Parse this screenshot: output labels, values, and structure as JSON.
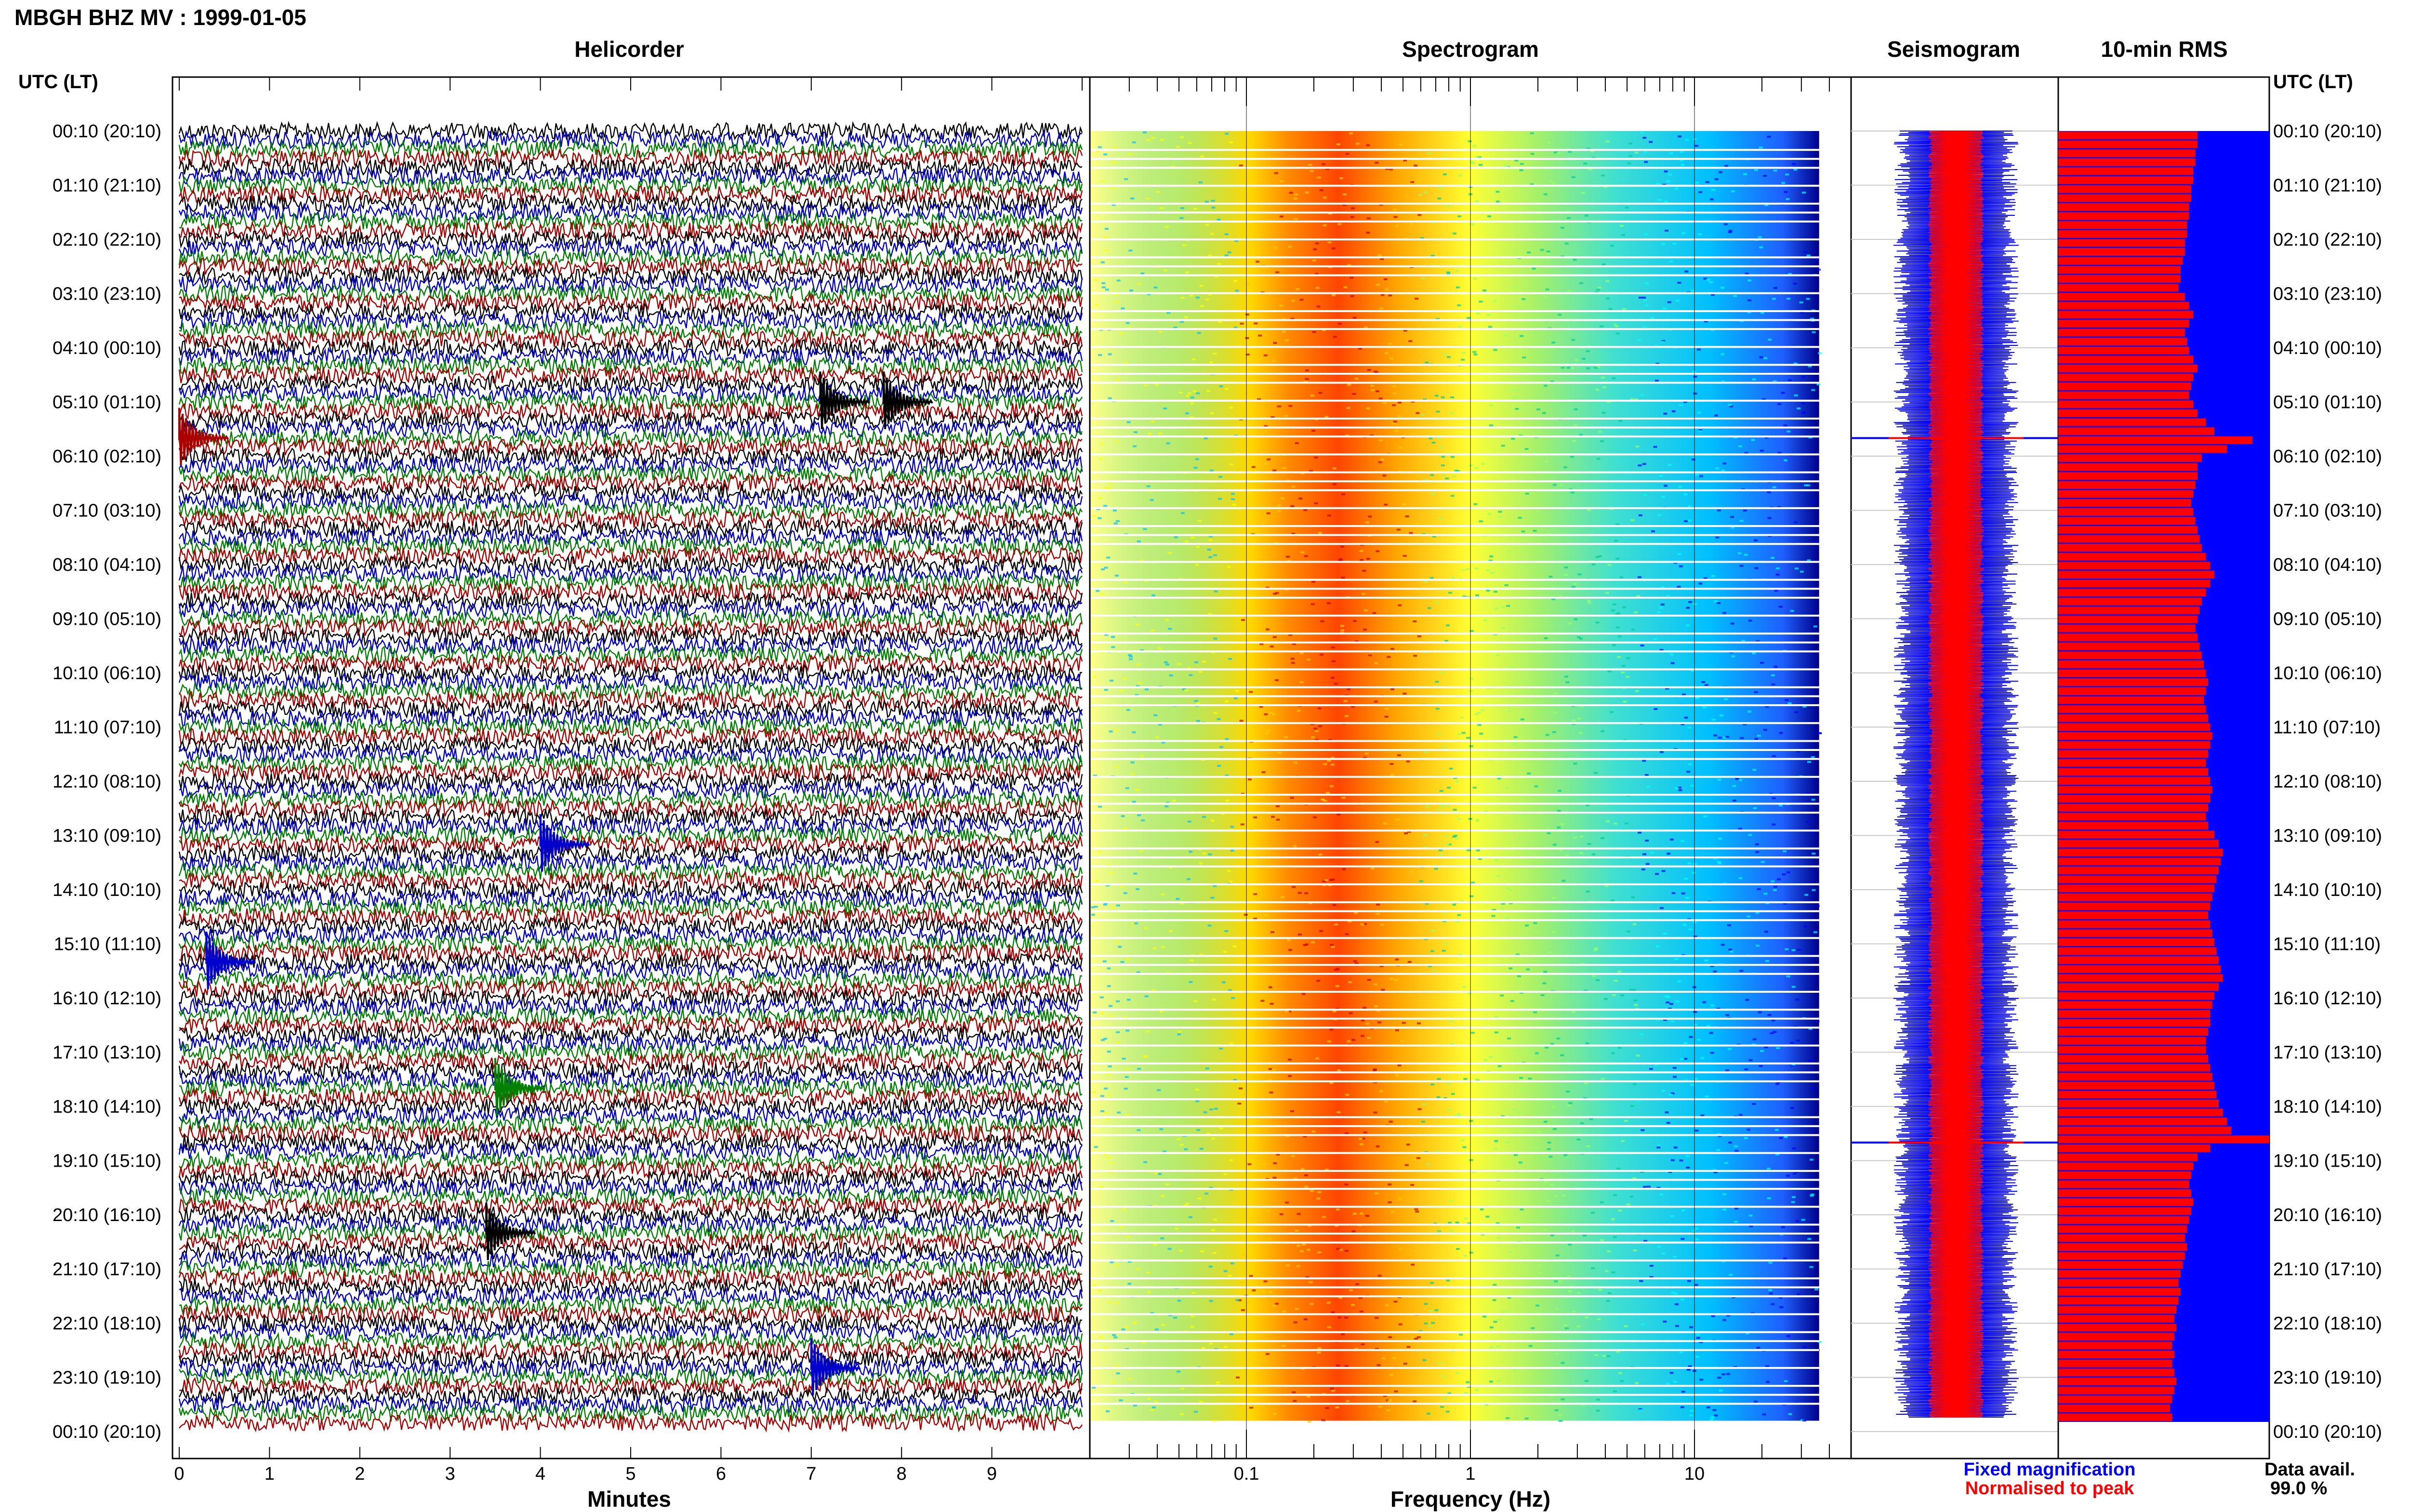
{
  "header": {
    "title": "MBGH BHZ MV : 1999-01-05",
    "utc_label_left": "UTC (LT)",
    "utc_label_right": "UTC (LT)"
  },
  "panels": {
    "helicorder": "Helicorder",
    "spectrogram": "Spectrogram",
    "seismogram": "Seismogram",
    "rms": "10-min RMS"
  },
  "time_labels": [
    "00:10 (20:10)",
    "01:10 (21:10)",
    "02:10 (22:10)",
    "03:10 (23:10)",
    "04:10 (00:10)",
    "05:10 (01:10)",
    "06:10 (02:10)",
    "07:10 (03:10)",
    "08:10 (04:10)",
    "09:10 (05:10)",
    "10:10 (06:10)",
    "11:10 (07:10)",
    "12:10 (08:10)",
    "13:10 (09:10)",
    "14:10 (10:10)",
    "15:10 (11:10)",
    "16:10 (12:10)",
    "17:10 (13:10)",
    "18:10 (14:10)",
    "19:10 (15:10)",
    "20:10 (16:10)",
    "21:10 (17:10)",
    "22:10 (18:10)",
    "23:10 (19:10)",
    "00:10 (20:10)"
  ],
  "legend": {
    "fixed": "Fixed magnification",
    "normalised": "Normalised to peak",
    "fixed_color": "#0000ff",
    "normalised_color": "#ff0000",
    "data_avail_label": "Data avail.",
    "data_avail_value": "99.0 %"
  },
  "chart_data": [
    {
      "type": "line",
      "panel": "Helicorder",
      "xlabel": "Minutes",
      "xlim": [
        0,
        10
      ],
      "x_ticks": [
        "0",
        "1",
        "2",
        "3",
        "4",
        "5",
        "6",
        "7",
        "8",
        "9"
      ],
      "ylim_utc": [
        "00:10",
        "00:10 next day"
      ],
      "trace_colors": [
        "#000000",
        "#0000cc",
        "#008000",
        "#aa0000"
      ],
      "events": [
        {
          "utc": "05:10",
          "minute": 7.1,
          "color": "#000000"
        },
        {
          "utc": "05:10",
          "minute": 7.8,
          "color": "#000000"
        },
        {
          "utc": "05:50",
          "minute": 0.0,
          "color": "#aa0000",
          "note_visible": false
        },
        {
          "utc": "13:20",
          "minute": 4.0,
          "color": "#0000cc"
        },
        {
          "utc": "15:30",
          "minute": 0.3,
          "color": "#0000cc"
        },
        {
          "utc": "17:50",
          "minute": 3.5,
          "color": "#008000"
        },
        {
          "utc": "20:30",
          "minute": 3.4,
          "color": "#000000"
        },
        {
          "utc": "23:00",
          "minute": 7.0,
          "color": "#0000cc"
        }
      ]
    },
    {
      "type": "heatmap",
      "panel": "Spectrogram",
      "xlabel": "Frequency (Hz)",
      "x_scale": "log",
      "xlim": [
        0.02,
        50
      ],
      "x_ticks": [
        "0.1",
        "1",
        "10"
      ],
      "colormap": [
        "#00008b",
        "#0000ff",
        "#00bfff",
        "#00ffff",
        "#7fff7f",
        "#ffff00",
        "#ffa500",
        "#ff4500",
        "#cc0000"
      ],
      "peak_band_hz": [
        0.18,
        0.5
      ],
      "missing_data_color": "#ffffff"
    },
    {
      "type": "line",
      "panel": "Seismogram",
      "series": [
        {
          "name": "Fixed magnification",
          "color": "#0000ff"
        },
        {
          "name": "Normalised to peak",
          "color": "#ff0000"
        }
      ],
      "spikes_utc": [
        "05:50",
        "18:50"
      ]
    },
    {
      "type": "bar",
      "panel": "10-min RMS",
      "orientation": "horizontal",
      "series": [
        {
          "name": "Fixed magnification",
          "color": "#0000ff"
        },
        {
          "name": "Normalised to peak",
          "color": "#ff0000"
        }
      ],
      "bins_per_hour": 6,
      "rms_relative": [
        0.66,
        0.66,
        0.65,
        0.65,
        0.64,
        0.64,
        0.63,
        0.63,
        0.62,
        0.62,
        0.61,
        0.61,
        0.6,
        0.6,
        0.59,
        0.58,
        0.58,
        0.57,
        0.6,
        0.62,
        0.64,
        0.62,
        0.6,
        0.61,
        0.62,
        0.64,
        0.66,
        0.64,
        0.63,
        0.62,
        0.64,
        0.66,
        0.7,
        0.74,
        0.92,
        0.8,
        0.68,
        0.66,
        0.66,
        0.65,
        0.64,
        0.63,
        0.64,
        0.65,
        0.66,
        0.67,
        0.68,
        0.7,
        0.72,
        0.74,
        0.72,
        0.7,
        0.68,
        0.67,
        0.66,
        0.65,
        0.66,
        0.67,
        0.68,
        0.69,
        0.7,
        0.71,
        0.7,
        0.69,
        0.7,
        0.71,
        0.72,
        0.73,
        0.72,
        0.71,
        0.7,
        0.71,
        0.72,
        0.73,
        0.72,
        0.71,
        0.7,
        0.71,
        0.74,
        0.76,
        0.78,
        0.77,
        0.76,
        0.75,
        0.74,
        0.73,
        0.72,
        0.71,
        0.72,
        0.73,
        0.74,
        0.75,
        0.76,
        0.77,
        0.78,
        0.76,
        0.74,
        0.73,
        0.72,
        0.72,
        0.71,
        0.7,
        0.7,
        0.71,
        0.72,
        0.73,
        0.74,
        0.75,
        0.76,
        0.78,
        0.8,
        0.82,
        1.0,
        0.72,
        0.66,
        0.64,
        0.63,
        0.62,
        0.63,
        0.64,
        0.63,
        0.62,
        0.61,
        0.6,
        0.61,
        0.6,
        0.59,
        0.58,
        0.57,
        0.58,
        0.57,
        0.56,
        0.55,
        0.56,
        0.55,
        0.54,
        0.55,
        0.54,
        0.55,
        0.56,
        0.55,
        0.54,
        0.53,
        0.54
      ]
    }
  ]
}
